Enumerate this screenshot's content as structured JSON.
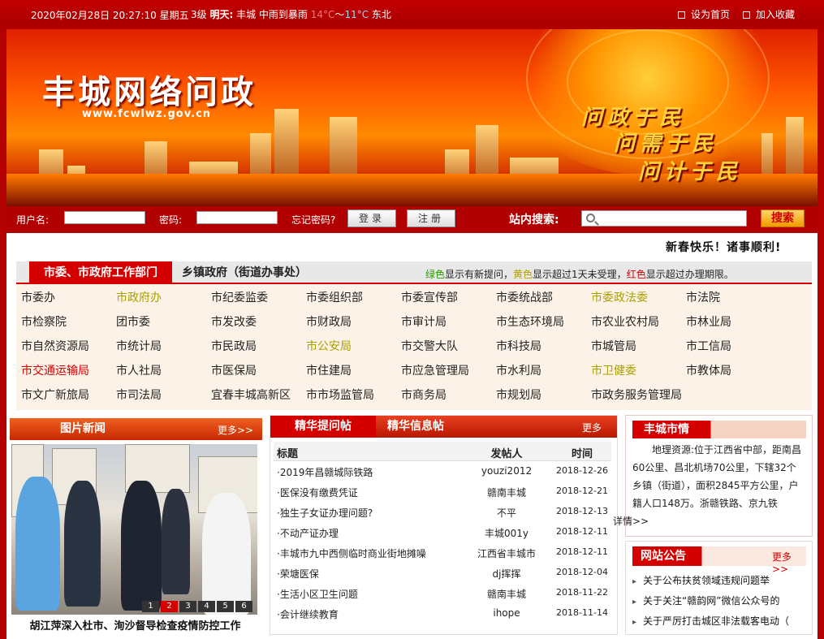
{
  "topbar": {
    "date": "2020年02月28日 20:27:10 星期五",
    "weather_prefix": "3级",
    "tomorrow_label": "明天:",
    "weather_desc": "丰城 中雨到暴雨",
    "temp_high": "14°C",
    "temp_sep": "～",
    "temp_low": "11°C",
    "wind": "东北",
    "set_home": "设为首页",
    "add_fav": "加入收藏"
  },
  "banner": {
    "title": "丰城网络问政",
    "url": "www.fcwlwz.gov.cn",
    "slogans": [
      "问政于民",
      "问需于民",
      "问计于民"
    ]
  },
  "login": {
    "user_label": "用户名:",
    "pass_label": "密码:",
    "forgot": "忘记密码?",
    "login_btn": "登录",
    "register_btn": "注册",
    "search_label": "站内搜索:",
    "search_btn": "搜索"
  },
  "greeting": "新春快乐！诸事顺利!",
  "dept": {
    "tab_active": "市委、市政府工作部门",
    "tab_other": "乡镇政府（街道办事处）",
    "legend": {
      "green": "绿色",
      "t1": "显示有新提问，",
      "yellow": "黄色",
      "t2": "显示超过1天未受理，",
      "red": "红色",
      "t3": "显示超过办理期限。"
    },
    "items": [
      {
        "name": "市委办",
        "status": "normal"
      },
      {
        "name": "市政府办",
        "status": "yellow"
      },
      {
        "name": "市纪委监委",
        "status": "normal"
      },
      {
        "name": "市委组织部",
        "status": "normal"
      },
      {
        "name": "市委宣传部",
        "status": "normal"
      },
      {
        "name": "市委统战部",
        "status": "normal"
      },
      {
        "name": "市委政法委",
        "status": "yellow"
      },
      {
        "name": "市法院",
        "status": "normal"
      },
      {
        "name": "市检察院",
        "status": "normal"
      },
      {
        "name": "团市委",
        "status": "normal"
      },
      {
        "name": "市发改委",
        "status": "normal"
      },
      {
        "name": "市财政局",
        "status": "normal"
      },
      {
        "name": "市审计局",
        "status": "normal"
      },
      {
        "name": "市生态环境局",
        "status": "normal"
      },
      {
        "name": "市农业农村局",
        "status": "normal"
      },
      {
        "name": "市林业局",
        "status": "normal"
      },
      {
        "name": "市自然资源局",
        "status": "normal"
      },
      {
        "name": "市统计局",
        "status": "normal"
      },
      {
        "name": "市民政局",
        "status": "normal"
      },
      {
        "name": "市公安局",
        "status": "yellow"
      },
      {
        "name": "市交警大队",
        "status": "normal"
      },
      {
        "name": "市科技局",
        "status": "normal"
      },
      {
        "name": "市城管局",
        "status": "normal"
      },
      {
        "name": "市工信局",
        "status": "normal"
      },
      {
        "name": "市交通运输局",
        "status": "red"
      },
      {
        "name": "市人社局",
        "status": "normal"
      },
      {
        "name": "市医保局",
        "status": "normal"
      },
      {
        "name": "市住建局",
        "status": "normal"
      },
      {
        "name": "市应急管理局",
        "status": "normal"
      },
      {
        "name": "市水利局",
        "status": "normal"
      },
      {
        "name": "市卫健委",
        "status": "yellow"
      },
      {
        "name": "市教体局",
        "status": "normal"
      },
      {
        "name": "市文广新旅局",
        "status": "normal"
      },
      {
        "name": "市司法局",
        "status": "normal"
      },
      {
        "name": "宜春丰城高新区",
        "status": "normal"
      },
      {
        "name": "市市场监管局",
        "status": "normal"
      },
      {
        "name": "市商务局",
        "status": "normal"
      },
      {
        "name": "市规划局",
        "status": "normal"
      },
      {
        "name": "市政务服务管理局",
        "status": "normal"
      }
    ]
  },
  "pic_news": {
    "title": "图片新闻",
    "more": "更多>>",
    "pages": [
      "1",
      "2",
      "3",
      "4",
      "5",
      "6"
    ],
    "active_page": "2",
    "caption": "胡江萍深入杜市、洵沙督导检查疫情防控工作"
  },
  "posts": {
    "tab_active": "精华提问帖",
    "tab_other": "精华信息帖",
    "more": "更多>>",
    "headers": {
      "title": "标题",
      "author": "发帖人",
      "time": "时间"
    },
    "rows": [
      {
        "title": "·2019年昌赣城际铁路",
        "author": "youzi2012",
        "time": "2018-12-26"
      },
      {
        "title": "·医保没有缴费凭证",
        "author": "赣南丰城",
        "time": "2018-12-21"
      },
      {
        "title": "·独生子女证办理问题?",
        "author": "不平",
        "time": "2018-12-13"
      },
      {
        "title": "·不动产证办理",
        "author": "丰城001y",
        "time": "2018-12-11"
      },
      {
        "title": "·丰城市九中西侧临时商业街地摊噪",
        "author": "江西省丰城市",
        "time": "2018-12-11"
      },
      {
        "title": "·荣塘医保",
        "author": "dj挥挥",
        "time": "2018-12-04"
      },
      {
        "title": "·生活小区卫生问题",
        "author": "赣南丰城",
        "time": "2018-11-22"
      },
      {
        "title": "·会计继续教育",
        "author": "ihope",
        "time": "2018-11-14"
      }
    ]
  },
  "city": {
    "title": "丰城市情",
    "text": "地理资源:位于江西省中部，距南昌60公里、昌北机场70公里，下辖32个乡镇（街道），面积2845平方公里，户籍人口148万。浙赣铁路、京九铁",
    "more": "详情>>"
  },
  "notice": {
    "title": "网站公告",
    "more": "更多>>",
    "items": [
      "关于公布扶贫领域违规问题举",
      "关于关注“赣韵网”微信公众号的",
      "关于严厉打击城区非法载客电动（"
    ]
  },
  "colors": {
    "brand_red": "#d40000",
    "status_green": "#2a9a00",
    "status_yellow": "#b5a000",
    "status_red": "#d40000"
  }
}
